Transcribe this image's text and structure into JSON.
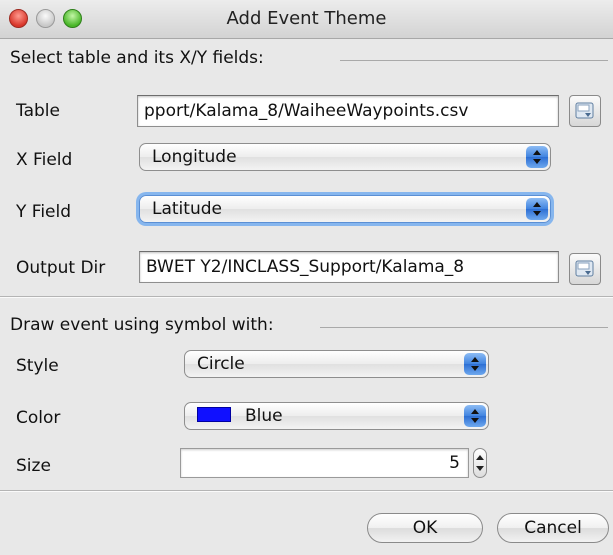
{
  "window": {
    "title": "Add Event Theme"
  },
  "table_group": {
    "heading": "Select table and its X/Y fields:",
    "table_label": "Table",
    "table_value": "pport/Kalama_8/WaiheeWaypoints.csv",
    "x_label": "X Field",
    "x_value": "Longitude",
    "y_label": "Y Field",
    "y_value": "Latitude",
    "output_label": "Output Dir",
    "output_value": "BWET Y2/INCLASS_Support/Kalama_8"
  },
  "symbol_group": {
    "heading": "Draw event using symbol with:",
    "style_label": "Style",
    "style_value": "Circle",
    "color_label": "Color",
    "color_value": "Blue",
    "color_hex": "#1010ff",
    "size_label": "Size",
    "size_value": "5"
  },
  "buttons": {
    "ok": "OK",
    "cancel": "Cancel"
  },
  "icons": {
    "window_controls": [
      "close-icon",
      "minimize-icon",
      "zoom-icon"
    ],
    "browse": "folder-browse-icon",
    "popup": "up-down-arrows-icon",
    "stepper": "stepper-arrows-icon"
  }
}
